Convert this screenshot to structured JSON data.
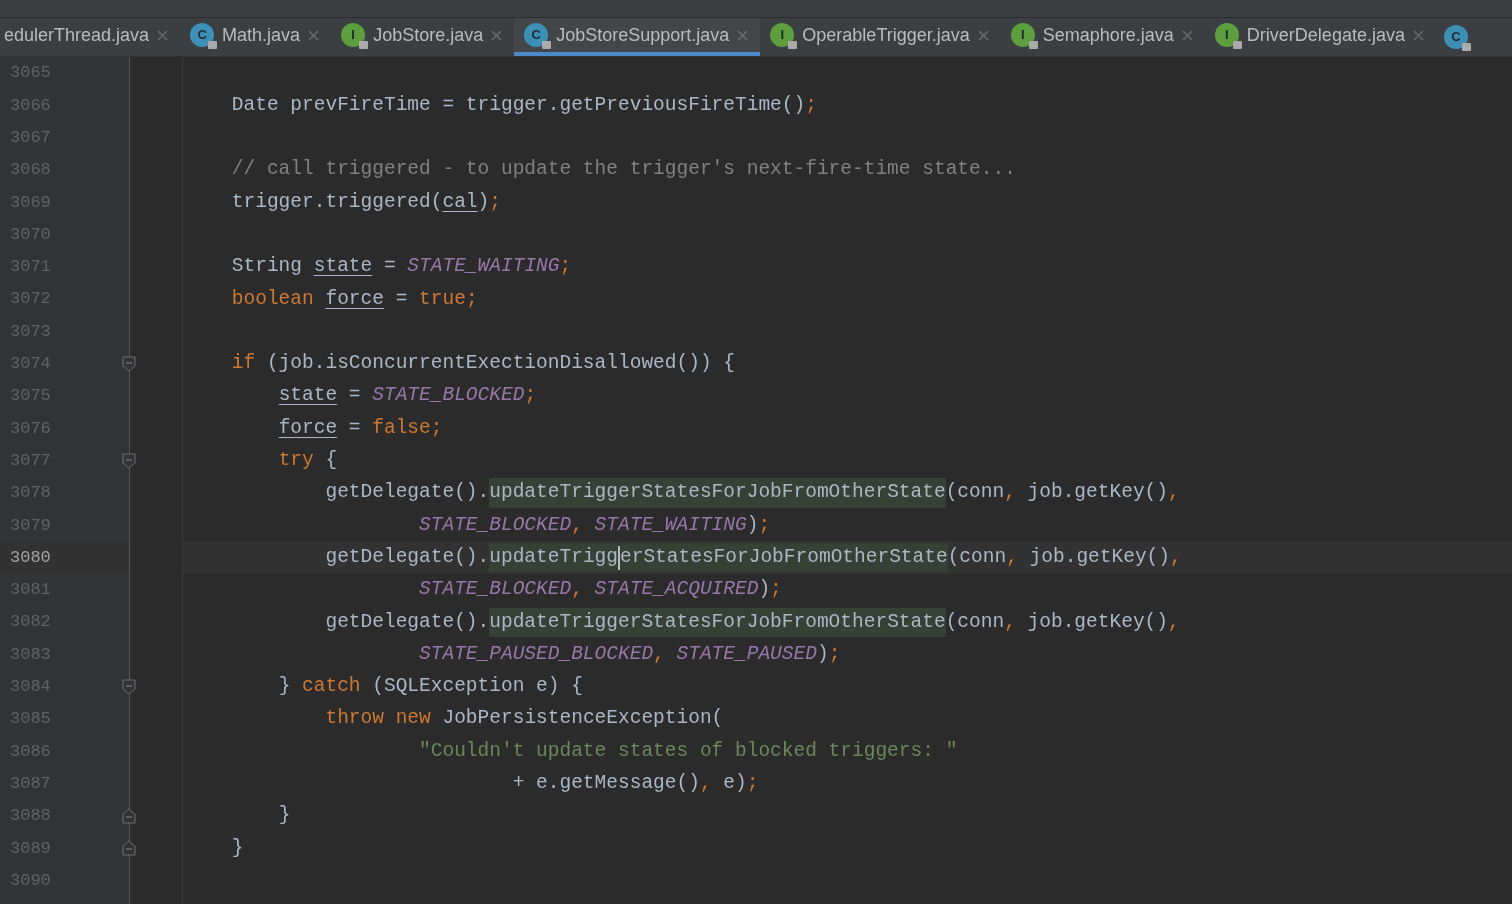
{
  "tabs": [
    {
      "label": "edulerThread.java",
      "selected": false
    },
    {
      "label": "Math.java",
      "icon": "C",
      "selected": false
    },
    {
      "label": "JobStore.java",
      "icon": "I",
      "selected": false
    },
    {
      "label": "JobStoreSupport.java",
      "icon": "C",
      "selected": true
    },
    {
      "label": "OperableTrigger.java",
      "icon": "I",
      "selected": false
    },
    {
      "label": "Semaphore.java",
      "icon": "I",
      "selected": false
    },
    {
      "label": "DriverDelegate.java",
      "icon": "I",
      "selected": false
    }
  ],
  "cut_off_tab": {
    "icon": "C"
  },
  "editor": {
    "lines": [
      {
        "number": "3065"
      },
      {
        "number": "3066",
        "tokens": [
          {
            "t": "    Date prevFireTime = trigger.getPreviousFireTime()",
            "kind": "plain"
          },
          {
            "t": ";",
            "kind": "punct"
          }
        ]
      },
      {
        "number": "3067"
      },
      {
        "number": "3068",
        "tokens": [
          {
            "t": "    // call triggered - to update the trigger's next-fire-time state...",
            "kind": "comment"
          }
        ]
      },
      {
        "number": "3069",
        "tokens": [
          {
            "t": "    trigger.triggered(",
            "kind": "plain"
          },
          {
            "t": "cal",
            "kind": "var"
          },
          {
            "t": ")",
            "kind": "plain"
          },
          {
            "t": ";",
            "kind": "punct"
          }
        ]
      },
      {
        "number": "3070"
      },
      {
        "number": "3071",
        "tokens": [
          {
            "t": "    String",
            "kind": "plain"
          },
          {
            "t": " state",
            "kind": "var"
          },
          {
            "t": " = ",
            "kind": "plain"
          },
          {
            "t": "STATE_WAITING",
            "kind": "const"
          },
          {
            "t": ";",
            "kind": "punct"
          }
        ]
      },
      {
        "number": "3072",
        "tokens": [
          {
            "t": "    boolean",
            "kind": "kw"
          },
          {
            "t": " force",
            "kind": "var"
          },
          {
            "t": " = ",
            "kind": "plain"
          },
          {
            "t": "true",
            "kind": "kw"
          },
          {
            "t": ";",
            "kind": "punct"
          }
        ]
      },
      {
        "number": "3073"
      },
      {
        "number": "3074",
        "fold_start": true,
        "tokens": [
          {
            "t": "    if",
            "kind": "kw"
          },
          {
            "t": " (job.isConcurrentExectionDisallowed()) {",
            "kind": "plain"
          }
        ]
      },
      {
        "number": "3075",
        "tokens": [
          {
            "t": "        state",
            "kind": "var"
          },
          {
            "t": " = ",
            "kind": "plain"
          },
          {
            "t": "STATE_BLOCKED",
            "kind": "const"
          },
          {
            "t": ";",
            "kind": "punct"
          }
        ]
      },
      {
        "number": "3076",
        "tokens": [
          {
            "t": "        force",
            "kind": "var"
          },
          {
            "t": " = ",
            "kind": "plain"
          },
          {
            "t": "false",
            "kind": "kw"
          },
          {
            "t": ";",
            "kind": "punct"
          }
        ]
      },
      {
        "number": "3077",
        "fold_start": true,
        "tokens": [
          {
            "t": "        try",
            "kind": "kw"
          },
          {
            "t": " {",
            "kind": "plain"
          }
        ]
      },
      {
        "number": "3078",
        "tokens": [
          {
            "t": "            getDelegate().",
            "kind": "plain"
          },
          {
            "t": "updateTriggerStatesForJobFromOtherState",
            "kind": "call"
          },
          {
            "t": "(conn",
            "kind": "plain"
          },
          {
            "t": ",",
            "kind": "punct"
          },
          {
            "t": " job.getKey()",
            "kind": "plain"
          },
          {
            "t": ",",
            "kind": "punct"
          }
        ]
      },
      {
        "number": "3079",
        "tokens": [
          {
            "t": "                    STATE_BLOCKED",
            "kind": "const"
          },
          {
            "t": ",",
            "kind": "punct"
          },
          {
            "t": " STATE_WAITING",
            "kind": "const"
          },
          {
            "t": ")",
            "kind": "plain"
          },
          {
            "t": ";",
            "kind": "punct"
          }
        ]
      },
      {
        "number": "3080",
        "current": true,
        "tokens": [
          {
            "t": "            getDelegate().",
            "kind": "plain"
          },
          {
            "t": "updateTrigg",
            "kind": "call"
          },
          {
            "kind": "caret"
          },
          {
            "t": "erStatesForJobFromOtherState",
            "kind": "call"
          },
          {
            "t": "(conn",
            "kind": "plain"
          },
          {
            "t": ",",
            "kind": "punct"
          },
          {
            "t": " job.getKey()",
            "kind": "plain"
          },
          {
            "t": ",",
            "kind": "punct"
          }
        ]
      },
      {
        "number": "3081",
        "tokens": [
          {
            "t": "                    STATE_BLOCKED",
            "kind": "const"
          },
          {
            "t": ",",
            "kind": "punct"
          },
          {
            "t": " STATE_ACQUIRED",
            "kind": "const"
          },
          {
            "t": ")",
            "kind": "plain"
          },
          {
            "t": ";",
            "kind": "punct"
          }
        ]
      },
      {
        "number": "3082",
        "tokens": [
          {
            "t": "            getDelegate().",
            "kind": "plain"
          },
          {
            "t": "updateTriggerStatesForJobFromOtherState",
            "kind": "call"
          },
          {
            "t": "(conn",
            "kind": "plain"
          },
          {
            "t": ",",
            "kind": "punct"
          },
          {
            "t": " job.getKey()",
            "kind": "plain"
          },
          {
            "t": ",",
            "kind": "punct"
          }
        ]
      },
      {
        "number": "3083",
        "tokens": [
          {
            "t": "                    STATE_PAUSED_BLOCKED",
            "kind": "const"
          },
          {
            "t": ",",
            "kind": "punct"
          },
          {
            "t": " STATE_PAUSED",
            "kind": "const"
          },
          {
            "t": ")",
            "kind": "plain"
          },
          {
            "t": ";",
            "kind": "punct"
          }
        ]
      },
      {
        "number": "3084",
        "fold_start": true,
        "tokens": [
          {
            "t": "        }",
            "kind": "plain"
          },
          {
            "t": " catch",
            "kind": "kw"
          },
          {
            "t": " (SQLException e) {",
            "kind": "plain"
          }
        ]
      },
      {
        "number": "3085",
        "tokens": [
          {
            "t": "            throw",
            "kind": "kw"
          },
          {
            "t": " new",
            "kind": "kw"
          },
          {
            "t": " JobPersistenceException(",
            "kind": "plain"
          }
        ]
      },
      {
        "number": "3086",
        "tokens": [
          {
            "t": "                    \"Couldn't update states of blocked triggers: \"",
            "kind": "str"
          }
        ]
      },
      {
        "number": "3087",
        "tokens": [
          {
            "t": "                            + e.getMessage()",
            "kind": "plain"
          },
          {
            "t": ",",
            "kind": "punct"
          },
          {
            "t": " e)",
            "kind": "plain"
          },
          {
            "t": ";",
            "kind": "punct"
          }
        ]
      },
      {
        "number": "3088",
        "fold_end": true,
        "tokens": [
          {
            "t": "        }",
            "kind": "plain"
          }
        ]
      },
      {
        "number": "3089",
        "fold_end": true,
        "tokens": [
          {
            "t": "    }",
            "kind": "plain"
          }
        ]
      },
      {
        "number": "3090"
      }
    ]
  }
}
